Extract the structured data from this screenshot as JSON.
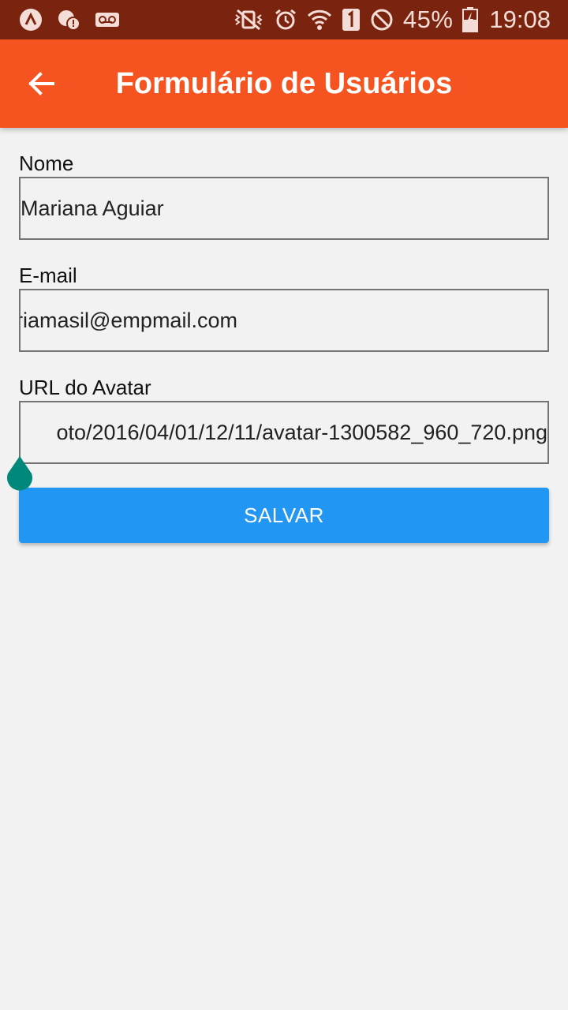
{
  "status_bar": {
    "icons": [
      "app-launcher-icon",
      "alert-icon",
      "voicemail-icon",
      "vibrate-icon",
      "alarm-icon",
      "wifi-icon",
      "sim-1-icon",
      "do-not-disturb-icon",
      "battery-icon"
    ],
    "battery": "45%",
    "time": "19:08"
  },
  "app_bar": {
    "title": "Formulário de Usuários",
    "back_icon": "arrow-back-icon",
    "color": "#f55420"
  },
  "form": {
    "name": {
      "label": "Nome",
      "value": "Mariana Aguiar"
    },
    "email": {
      "label": "E-mail",
      "value": "riamasil@empmail.com"
    },
    "avatar_url": {
      "label": "URL do Avatar",
      "value": "oto/2016/04/01/12/11/avatar-1300582_960_720.png"
    },
    "save_button": {
      "label": "SALVAR",
      "color": "#2196f3"
    }
  },
  "colors": {
    "status_bar": "#7a2410",
    "background": "#f2f2f2",
    "cursor_handle": "#00897b"
  }
}
